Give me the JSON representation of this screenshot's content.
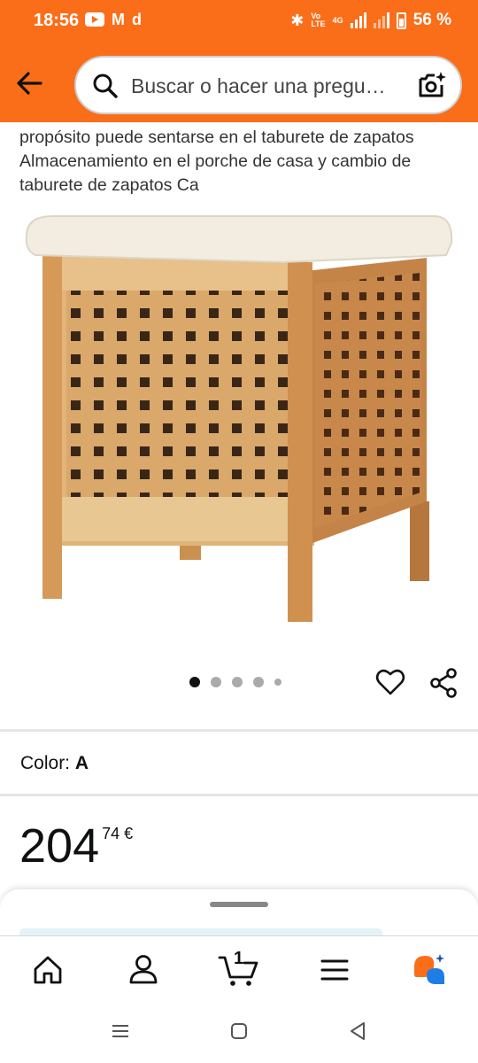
{
  "status_bar": {
    "time": "18:56",
    "network_label_top": "Vo",
    "network_label_bottom": "LTE",
    "lte_label": "4G",
    "battery_percent": "56 %"
  },
  "header": {
    "search_placeholder": "Buscar o hacer una pregu…"
  },
  "product": {
    "title_lines": "propósito puede sentarse en el taburete de zapatos Almacenamiento en el porche de casa y cambio de taburete de zapatos Ca",
    "image_count": 5,
    "active_image": 1
  },
  "options": {
    "color_label": "Color:",
    "color_value": "A"
  },
  "price": {
    "whole": "204",
    "fraction": "74 €"
  },
  "tabs": {
    "cart_count": "1"
  },
  "colors": {
    "accent": "#fa6e1a",
    "text": "#0f1111"
  }
}
